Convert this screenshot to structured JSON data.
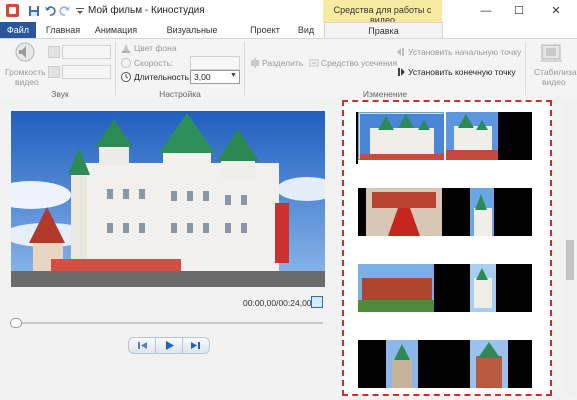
{
  "window": {
    "title": "Мой фильм - Киностудия",
    "context_group": "Средства для работы с видео",
    "minimize": "—",
    "maximize": "☐",
    "close": "✕"
  },
  "tabs": [
    {
      "label": "Файл"
    },
    {
      "label": "Главная"
    },
    {
      "label": "Анимация"
    },
    {
      "label": "Визуальные эффекты"
    },
    {
      "label": "Проект"
    },
    {
      "label": "Вид"
    },
    {
      "label": "Правка"
    }
  ],
  "ribbon": {
    "sound": {
      "label": "Звук",
      "volume_label_1": "Громкость",
      "volume_label_2": "видео"
    },
    "settings": {
      "label": "Настройка",
      "bg_color": "Цвет фона",
      "speed": "Скорость:",
      "duration": "Длительность:",
      "duration_value": "3,00"
    },
    "edit": {
      "label": "Изменение",
      "split": "Разделить",
      "trim": "Средство усечения",
      "set_start": "Установить начальную точку",
      "set_end": "Установить конечную точку"
    },
    "stabilize": {
      "label_1": "Стабилизация",
      "label_2": "видео"
    }
  },
  "player": {
    "timecode": "00:00,00/00:24,00"
  },
  "colors": {
    "file_tab": "#2b579a",
    "context_tab": "#f9eaa2",
    "highlight_border": "#d62b2b"
  }
}
